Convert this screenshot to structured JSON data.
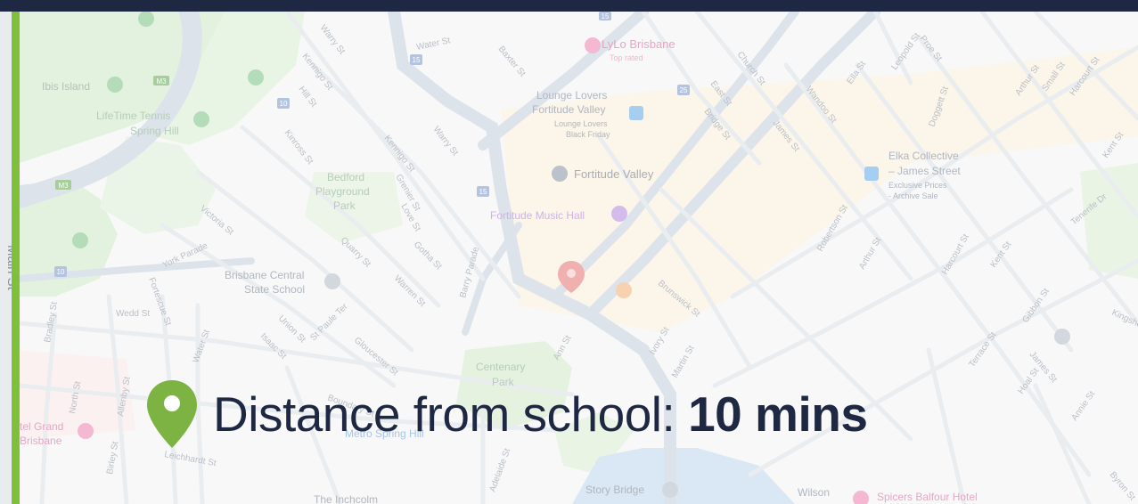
{
  "caption": {
    "prefix": "Distance from school: ",
    "value": "10 mins"
  },
  "map": {
    "side_label": "Main St",
    "places": {
      "lylo": "LyLo Brisbane",
      "lylo_sub": "Top rated",
      "lounge_lovers": "Lounge Lovers",
      "fortitude_valley_sub": "Fortitude Valley",
      "lounge_lovers_sub1": "Lounge Lovers",
      "lounge_lovers_sub2": "Black Friday",
      "fortitude_valley": "Fortitude Valley",
      "music_hall": "Fortitude Music Hall",
      "elka": "Elka Collective",
      "elka_sub1": "– James Street",
      "elka_sub2": "Exclusive Prices",
      "elka_sub3": "- Archive Sale",
      "ibis": "Ibis Island",
      "lifetime1": "LifeTime Tennis",
      "lifetime2": "Spring Hill",
      "bedford1": "Bedford",
      "bedford2": "Playground",
      "bedford3": "Park",
      "bcs1": "Brisbane Central",
      "bcs2": "State School",
      "centenary1": "Centenary",
      "centenary2": "Park",
      "story_bridge": "Story Bridge",
      "wilson": "Wilson",
      "spicers": "Spicers Balfour Hotel",
      "inchcolm": "The Inchcolm",
      "hotel_grand1": "tel Grand",
      "hotel_grand2": "Brisbane",
      "metro": "Metro Spring Hill"
    },
    "streets": {
      "water": "Water St",
      "baxter": "Baxter St",
      "warry": "Warry St",
      "kennigo": "Kennigo St",
      "hill": "Hill St",
      "kinross": "Kinross St",
      "church": "Church St",
      "east": "East St",
      "bridge": "Bridge St",
      "james": "James St",
      "wandoo": "Wandoo St",
      "ella": "Ella St",
      "leopold": "Leopold St",
      "proe": "Proe St",
      "doggett": "Doggett St",
      "arthur": "Arthur St",
      "small": "Small St",
      "harcourt": "Harcourt St",
      "kent": "Kent St",
      "grenier": "Grenier St",
      "love": "Love St",
      "victoria": "Victoria St",
      "quarry": "Quarry St",
      "gotha": "Gotha St",
      "barry": "Barry Parade",
      "york": "York Parade",
      "fortescue": "Fortescue St",
      "warren": "Warren St",
      "robertson": "Robertson St",
      "brunswick": "Brunswick St",
      "ivory": "Ivory St",
      "martin": "Martin St",
      "ann": "Ann St",
      "wedd": "Wedd St",
      "bradley": "Bradley St",
      "north": "North St",
      "allenby": "Allenby St",
      "union": "Union St",
      "isaac": "Isaac St",
      "stpaule": "St Paule Ter",
      "gloucester": "Gloucester St",
      "water2": "Water St",
      "boundary": "Boundary St",
      "leichhardt": "Leichhardt St",
      "birley": "Birley St",
      "adelaide": "Adelaide St",
      "gibbon": "Gibbon St",
      "terrace": "Terrace St",
      "hoal": "Hoal St",
      "annie": "Annie St",
      "tenerife": "Tenerife Dr",
      "kingsholme": "Kingsho",
      "byron": "Byron St"
    },
    "road_badges": [
      "M3",
      "M3",
      "15",
      "15",
      "15",
      "25",
      "10",
      "10"
    ]
  }
}
